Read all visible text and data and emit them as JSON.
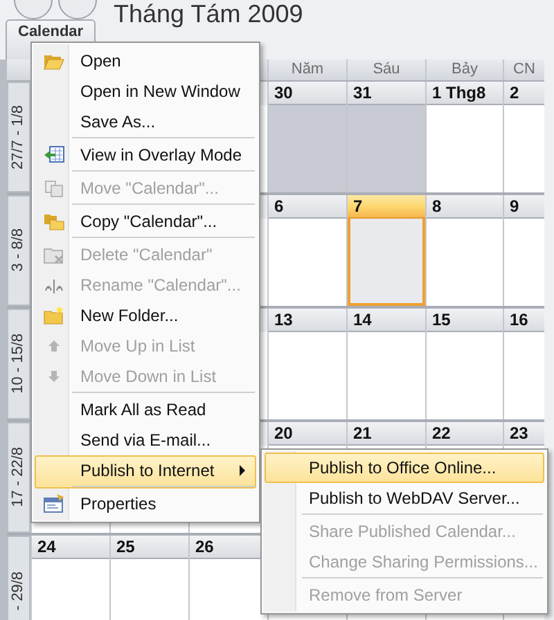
{
  "window": {
    "title": "Tháng Tám 2009"
  },
  "tab": {
    "label": "Calendar"
  },
  "day_headers": [
    "Năm",
    "Sáu",
    "Bảy",
    "CN"
  ],
  "weeks": [
    {
      "label": "27/7 - 1/8",
      "days": [
        {
          "date": "30",
          "out_of_month": true,
          "selected": false
        },
        {
          "date": "31",
          "out_of_month": true,
          "selected": false
        },
        {
          "date": "1 Thg8",
          "out_of_month": false,
          "selected": false
        },
        {
          "date": "2",
          "out_of_month": false,
          "selected": false
        }
      ]
    },
    {
      "label": "3 - 8/8",
      "days": [
        {
          "date": "6",
          "out_of_month": false,
          "selected": false
        },
        {
          "date": "7",
          "out_of_month": false,
          "selected": true
        },
        {
          "date": "8",
          "out_of_month": false,
          "selected": false
        },
        {
          "date": "9",
          "out_of_month": false,
          "selected": false
        }
      ]
    },
    {
      "label": "10 - 15/8",
      "days": [
        {
          "date": "13",
          "out_of_month": false,
          "selected": false
        },
        {
          "date": "14",
          "out_of_month": false,
          "selected": false
        },
        {
          "date": "15",
          "out_of_month": false,
          "selected": false
        },
        {
          "date": "16",
          "out_of_month": false,
          "selected": false
        }
      ]
    },
    {
      "label": "17 - 22/8",
      "days": [
        {
          "date": "20",
          "out_of_month": false,
          "selected": false
        },
        {
          "date": "21",
          "out_of_month": false,
          "selected": false
        },
        {
          "date": "22",
          "out_of_month": false,
          "selected": false
        },
        {
          "date": "23",
          "out_of_month": false,
          "selected": false
        }
      ]
    },
    {
      "label": "- 29/8",
      "days": [
        {
          "date": "24",
          "out_of_month": false,
          "selected": false
        },
        {
          "date": "25",
          "out_of_month": false,
          "selected": false
        },
        {
          "date": "26",
          "out_of_month": false,
          "selected": false
        }
      ]
    }
  ],
  "context_menu": {
    "items": [
      {
        "label": "Open",
        "disabled": false,
        "selected": false,
        "has_submenu": false,
        "separator_after": false
      },
      {
        "label": "Open in New Window",
        "disabled": false,
        "selected": false,
        "has_submenu": false,
        "separator_after": false
      },
      {
        "label": "Save As...",
        "disabled": false,
        "selected": false,
        "has_submenu": false,
        "separator_after": true
      },
      {
        "label": "View in Overlay Mode",
        "disabled": false,
        "selected": false,
        "has_submenu": false,
        "separator_after": true
      },
      {
        "label": "Move \"Calendar\"...",
        "disabled": true,
        "selected": false,
        "has_submenu": false,
        "separator_after": true
      },
      {
        "label": "Copy \"Calendar\"...",
        "disabled": false,
        "selected": false,
        "has_submenu": false,
        "separator_after": true
      },
      {
        "label": "Delete \"Calendar\"",
        "disabled": true,
        "selected": false,
        "has_submenu": false,
        "separator_after": false
      },
      {
        "label": "Rename \"Calendar\"...",
        "disabled": true,
        "selected": false,
        "has_submenu": false,
        "separator_after": false
      },
      {
        "label": "New Folder...",
        "disabled": false,
        "selected": false,
        "has_submenu": false,
        "separator_after": false
      },
      {
        "label": "Move Up in List",
        "disabled": true,
        "selected": false,
        "has_submenu": false,
        "separator_after": false
      },
      {
        "label": "Move Down in List",
        "disabled": true,
        "selected": false,
        "has_submenu": false,
        "separator_after": true
      },
      {
        "label": "Mark All as Read",
        "disabled": false,
        "selected": false,
        "has_submenu": false,
        "separator_after": false
      },
      {
        "label": "Send via E-mail...",
        "disabled": false,
        "selected": false,
        "has_submenu": false,
        "separator_after": false
      },
      {
        "label": "Publish to Internet",
        "disabled": false,
        "selected": true,
        "has_submenu": true,
        "separator_after": true
      },
      {
        "label": "Properties",
        "disabled": false,
        "selected": false,
        "has_submenu": false,
        "separator_after": false
      }
    ]
  },
  "submenu": {
    "items": [
      {
        "label": "Publish to Office Online...",
        "disabled": false,
        "selected": true,
        "separator_after": false
      },
      {
        "label": "Publish to WebDAV Server...",
        "disabled": false,
        "selected": false,
        "separator_after": true
      },
      {
        "label": "Share Published Calendar...",
        "disabled": true,
        "selected": false,
        "separator_after": false
      },
      {
        "label": "Change Sharing Permissions...",
        "disabled": true,
        "selected": false,
        "separator_after": true
      },
      {
        "label": "Remove from Server",
        "disabled": true,
        "selected": false,
        "separator_after": false
      }
    ]
  }
}
